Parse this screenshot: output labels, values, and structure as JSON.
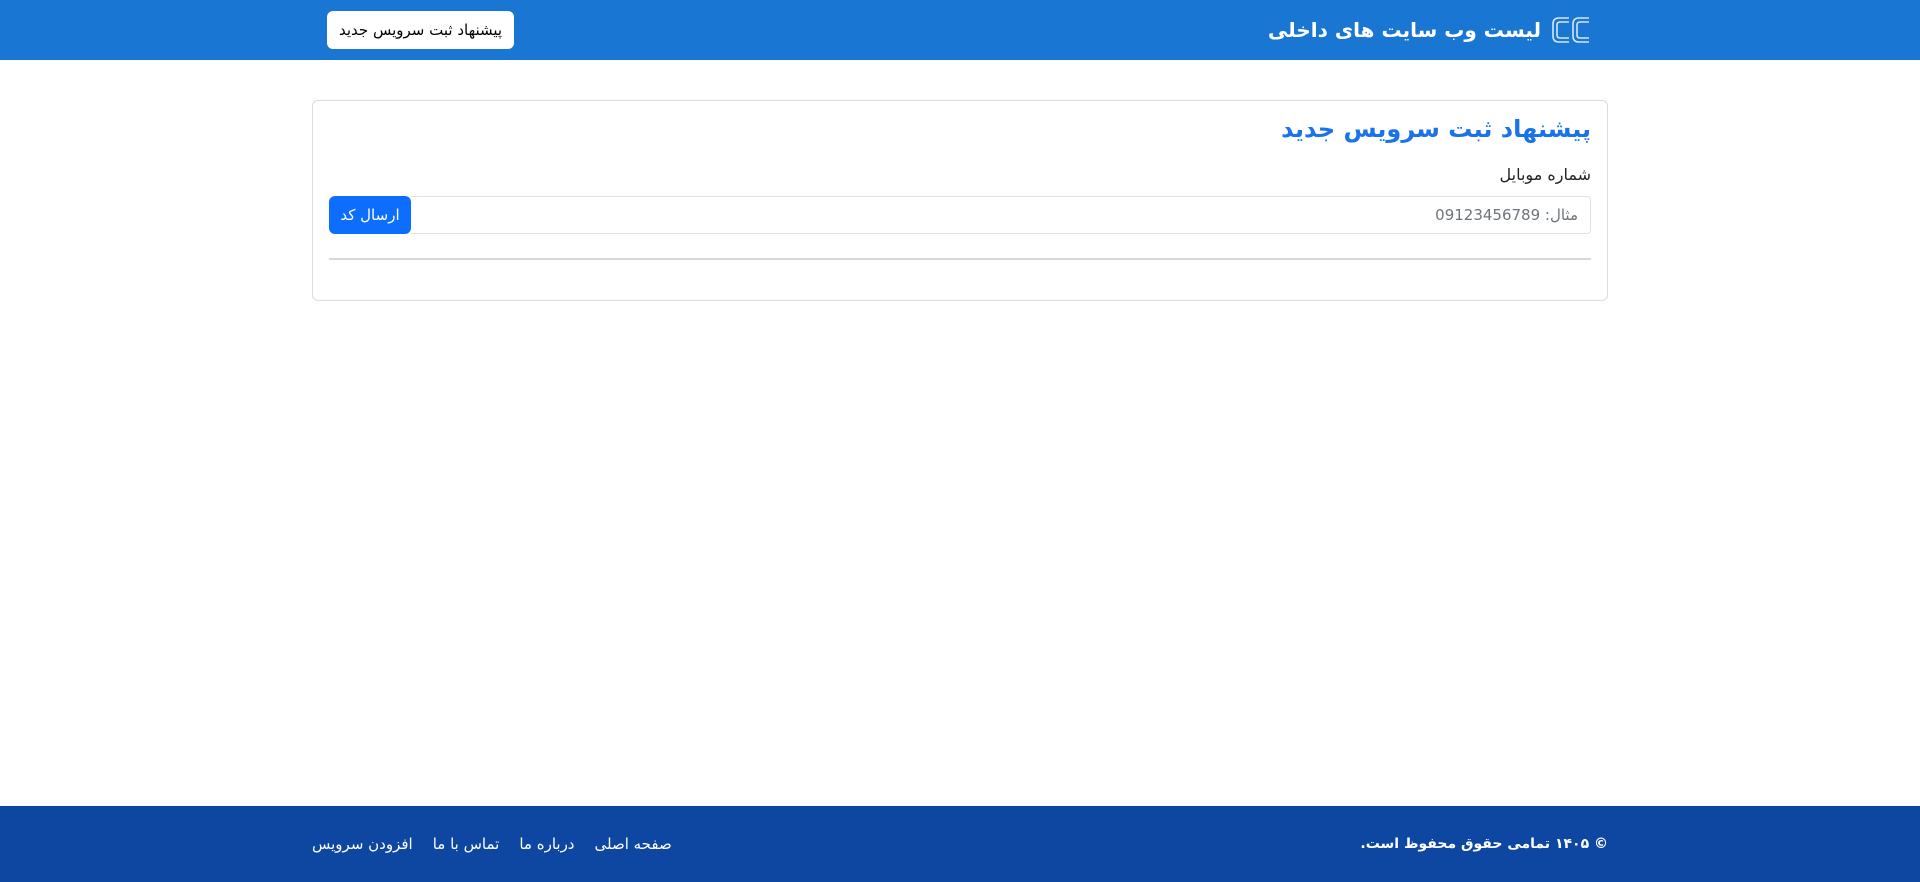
{
  "navbar": {
    "brand_title": "لیست وب سایت های داخلی",
    "brand_logo_icon": "cc-logo-icon",
    "suggest_button": "پیشنهاد ثبت سرویس جدید",
    "bg_color": "#1976d2"
  },
  "main": {
    "card_title": "پیشنهاد ثبت سرویس جدید",
    "mobile_label": "شماره موبایل",
    "mobile_placeholder": "مثال: 09123456789",
    "mobile_value": "",
    "send_code_button": "ارسال کد",
    "accent_color": "#0d6efd"
  },
  "footer": {
    "copyright": "© ۱۴۰۵ تمامی حقوق محفوظ است.",
    "links": [
      {
        "label": "صفحه اصلی"
      },
      {
        "label": "درباره ما"
      },
      {
        "label": "تماس با ما"
      },
      {
        "label": "افزودن سرویس"
      }
    ],
    "bg_color": "#0d47a1"
  }
}
